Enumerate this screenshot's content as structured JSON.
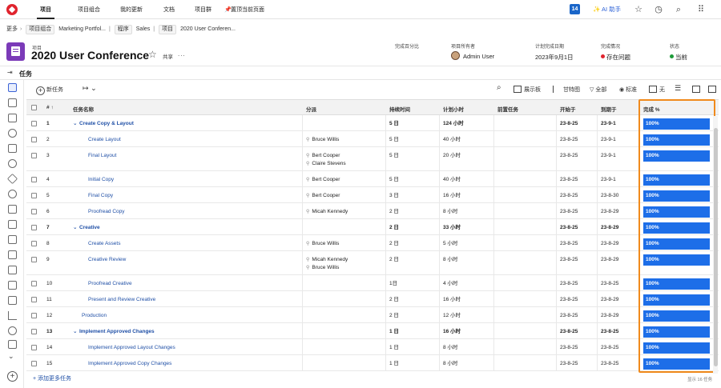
{
  "nav": {
    "items": [
      "项目",
      "项目组合",
      "我的更新",
      "文档",
      "项目群",
      "置顶当前页面"
    ],
    "notification_count": "14",
    "ai_label": "AI 助手"
  },
  "breadcrumb": {
    "more": "更多",
    "items": [
      {
        "type": "项目组合",
        "text": "Marketing Portfol..."
      },
      {
        "type": "程序",
        "text": "Sales"
      },
      {
        "type": "项目",
        "text": "2020 User Conferen..."
      }
    ]
  },
  "project": {
    "type_label": "项目",
    "title": "2020 User Conference",
    "share": "共享",
    "more": "...",
    "meta": [
      {
        "label": "完成百分比",
        "value": ""
      },
      {
        "label": "项目所有者",
        "value": "Admin User"
      },
      {
        "label": "计划完成日期",
        "value": "2023年9月1日"
      },
      {
        "label": "完成情况",
        "value": "存在问题",
        "color": "#e0242e"
      },
      {
        "label": "状态",
        "value": "当前",
        "color": "#1e9b3a"
      }
    ]
  },
  "tasktab": {
    "label": "任务"
  },
  "toolbar": {
    "new_task": "新任务",
    "board": "展示板",
    "gantt": "甘特图",
    "all": "全部",
    "standard": "标准",
    "none": "无"
  },
  "table": {
    "headers": [
      "#",
      "任务名称",
      "分派",
      "持续时间",
      "计划小时",
      "前置任务",
      "开始于",
      "到期于",
      "完成 %"
    ],
    "rows": [
      {
        "num": "1",
        "name": "Create Copy & Layout",
        "parent": true,
        "assign": [],
        "duration": "5 日",
        "hours": "124 小时",
        "pred": "",
        "start": "23-8-25",
        "due": "23-9-1",
        "pct": "100%"
      },
      {
        "num": "2",
        "name": "Create Layout",
        "parent": false,
        "assign": [
          "Bruce Willis"
        ],
        "duration": "5 日",
        "hours": "40 小时",
        "pred": "",
        "start": "23-8-25",
        "due": "23-9-1",
        "pct": "100%"
      },
      {
        "num": "3",
        "name": "Final Layout",
        "parent": false,
        "assign": [
          "Bert Cooper",
          "Claire Stevens"
        ],
        "duration": "5 日",
        "hours": "20 小时",
        "pred": "",
        "start": "23-8-25",
        "due": "23-9-1",
        "pct": "100%"
      },
      {
        "num": "4",
        "name": "Initial Copy",
        "parent": false,
        "assign": [
          "Bert Cooper"
        ],
        "duration": "5 日",
        "hours": "40 小时",
        "pred": "",
        "start": "23-8-25",
        "due": "23-9-1",
        "pct": "100%"
      },
      {
        "num": "5",
        "name": "Final Copy",
        "parent": false,
        "assign": [
          "Bert Cooper"
        ],
        "duration": "3 日",
        "hours": "16 小时",
        "pred": "",
        "start": "23-8-25",
        "due": "23-8-30",
        "pct": "100%"
      },
      {
        "num": "6",
        "name": "Proofread Copy",
        "parent": false,
        "assign": [
          "Micah Kennedy"
        ],
        "duration": "2 日",
        "hours": "8 小时",
        "pred": "",
        "start": "23-8-25",
        "due": "23-8-29",
        "pct": "100%"
      },
      {
        "num": "7",
        "name": "Creative",
        "parent": true,
        "assign": [],
        "duration": "2 日",
        "hours": "33 小时",
        "pred": "",
        "start": "23-8-25",
        "due": "23-8-29",
        "pct": "100%"
      },
      {
        "num": "8",
        "name": "Create Assets",
        "parent": false,
        "assign": [
          "Bruce Willis"
        ],
        "duration": "2 日",
        "hours": "5 小时",
        "pred": "",
        "start": "23-8-25",
        "due": "23-8-29",
        "pct": "100%"
      },
      {
        "num": "9",
        "name": "Creative Review",
        "parent": false,
        "assign": [
          "Micah Kennedy",
          "Bruce Willis"
        ],
        "duration": "2 日",
        "hours": "8 小时",
        "pred": "",
        "start": "23-8-25",
        "due": "23-8-29",
        "pct": "100%"
      },
      {
        "num": "10",
        "name": "Proofread Creative",
        "parent": false,
        "assign": [],
        "duration": "1日",
        "hours": "4 小时",
        "pred": "",
        "start": "23-8-25",
        "due": "23-8-25",
        "pct": "100%"
      },
      {
        "num": "11",
        "name": "Present and Review Creative",
        "parent": false,
        "assign": [],
        "duration": "2 日",
        "hours": "16 小时",
        "pred": "",
        "start": "23-8-25",
        "due": "23-8-29",
        "pct": "100%"
      },
      {
        "num": "12",
        "name": "Production",
        "parent": false,
        "level0": true,
        "assign": [],
        "duration": "2 日",
        "hours": "12 小时",
        "pred": "",
        "start": "23-8-25",
        "due": "23-8-29",
        "pct": "100%"
      },
      {
        "num": "13",
        "name": "Implement Approved Changes",
        "parent": true,
        "assign": [],
        "duration": "1 日",
        "hours": "16 小时",
        "pred": "",
        "start": "23-8-25",
        "due": "23-8-25",
        "pct": "100%"
      },
      {
        "num": "14",
        "name": "Implement Approved Layout Changes",
        "parent": false,
        "assign": [],
        "duration": "1 日",
        "hours": "8 小时",
        "pred": "",
        "start": "23-8-25",
        "due": "23-8-25",
        "pct": "100%"
      },
      {
        "num": "15",
        "name": "Implement Approved Copy Changes",
        "parent": false,
        "assign": [],
        "duration": "1 日",
        "hours": "8 小时",
        "pred": "",
        "start": "23-8-25",
        "due": "23-8-25",
        "pct": "100%"
      }
    ],
    "add_more": "+ 添加更多任务",
    "footer_count": "显示 16 任务"
  }
}
